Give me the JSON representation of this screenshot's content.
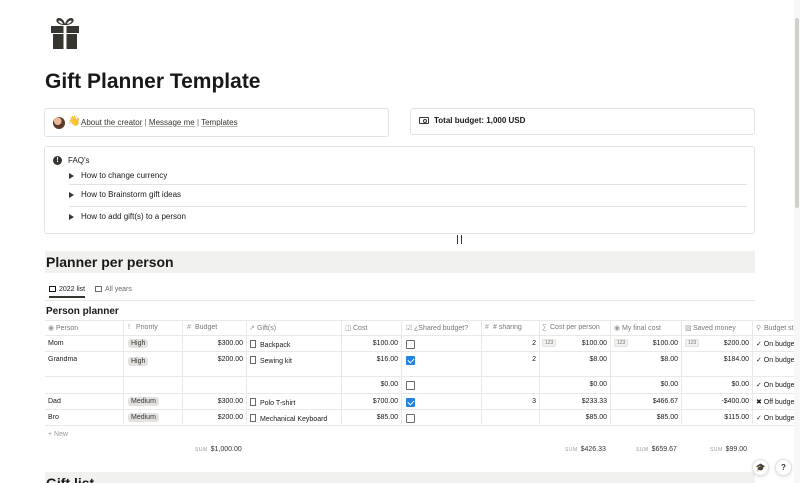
{
  "page": {
    "icon": "gift-icon",
    "title": "Gift Planner Template"
  },
  "creator_callout": {
    "icons": [
      "avatar",
      "waving-hand-icon"
    ],
    "about": "About the creator",
    "sep1": "|",
    "message": "Message me",
    "sep2": "|",
    "templates": "Templates"
  },
  "budget_callout": {
    "icon": "money-icon",
    "text": "Total budget: 1,000 USD"
  },
  "faq": {
    "icon": "info-icon",
    "title": "FAQ's",
    "toggles": [
      "How to change currency",
      "How to Brainstorm gift ideas",
      "How to add gift(s) to a person"
    ]
  },
  "section1": {
    "title": "Planner per person"
  },
  "section2": {
    "title": "Gift list"
  },
  "views": {
    "tabs": [
      {
        "label": "2022 list",
        "active": true
      },
      {
        "label": "All years",
        "active": false
      }
    ]
  },
  "database": {
    "title": "Person planner",
    "columns": [
      {
        "label": "Person",
        "icon": "person-icon"
      },
      {
        "label": "Priority",
        "icon": "exclamation-icon"
      },
      {
        "label": "Budget",
        "icon": "hash-icon"
      },
      {
        "label": "Gift(s)",
        "icon": "relation-icon"
      },
      {
        "label": "Cost",
        "icon": "rollup-icon"
      },
      {
        "label": "¿Shared budget?",
        "icon": "checkbox-icon"
      },
      {
        "label": "# sharing",
        "icon": "hash-icon"
      },
      {
        "label": "Cost per person",
        "icon": "formula-icon"
      },
      {
        "label": "My final cost",
        "icon": "person-icon"
      },
      {
        "label": "Saved money",
        "icon": "bag-icon"
      },
      {
        "label": "Budget sta",
        "icon": "search-icon"
      }
    ],
    "rows": [
      {
        "person": "Mom",
        "priority": "High",
        "budget": "$300.00",
        "gift": "Backpack",
        "cost": "$100.00",
        "shared": false,
        "sharing": "2",
        "cost_pp": "$100.00",
        "final": "$100.00",
        "saved": "$200.00",
        "status": "✓ On budget"
      },
      {
        "person": "Grandma",
        "priority": "High",
        "budget": "$200.00",
        "gift": "Sewing kit",
        "cost": "$16.00",
        "shared": true,
        "sharing": "2",
        "cost_pp": "$8.00",
        "final": "$8.00",
        "saved": "$184.00",
        "status": "✓ On budget"
      },
      {
        "person": "",
        "priority": "",
        "budget": "",
        "gift": "",
        "cost": "$0.00",
        "shared": false,
        "sharing": "",
        "cost_pp": "$0.00",
        "final": "$0.00",
        "saved": "$0.00",
        "status": "✓ On budget"
      },
      {
        "person": "Dad",
        "priority": "Medium",
        "budget": "$300.00",
        "gift": "Polo T-shirt",
        "cost": "$700.00",
        "shared": true,
        "sharing": "3",
        "cost_pp": "$233.33",
        "final": "$466.67",
        "saved": "-$400.00",
        "status": "✖ Off budget"
      },
      {
        "person": "Bro",
        "priority": "Medium",
        "budget": "$200.00",
        "gift": "Mechanical Keyboard",
        "cost": "$85.00",
        "shared": false,
        "sharing": "",
        "cost_pp": "$85.00",
        "final": "$85.00",
        "saved": "$115.00",
        "status": "✓ On budget"
      }
    ],
    "new_label": "+ New",
    "sums": {
      "label": "SUM",
      "budget": "$1,000.00",
      "cost_pp": "$426.33",
      "final": "$659.67",
      "saved": "$99.00"
    }
  },
  "floating": {
    "help": "?"
  },
  "colors": {
    "accent_blue": "#2383e2",
    "tag_gray": "#e3e2e0",
    "heading_bg": "#f1f1ef"
  }
}
